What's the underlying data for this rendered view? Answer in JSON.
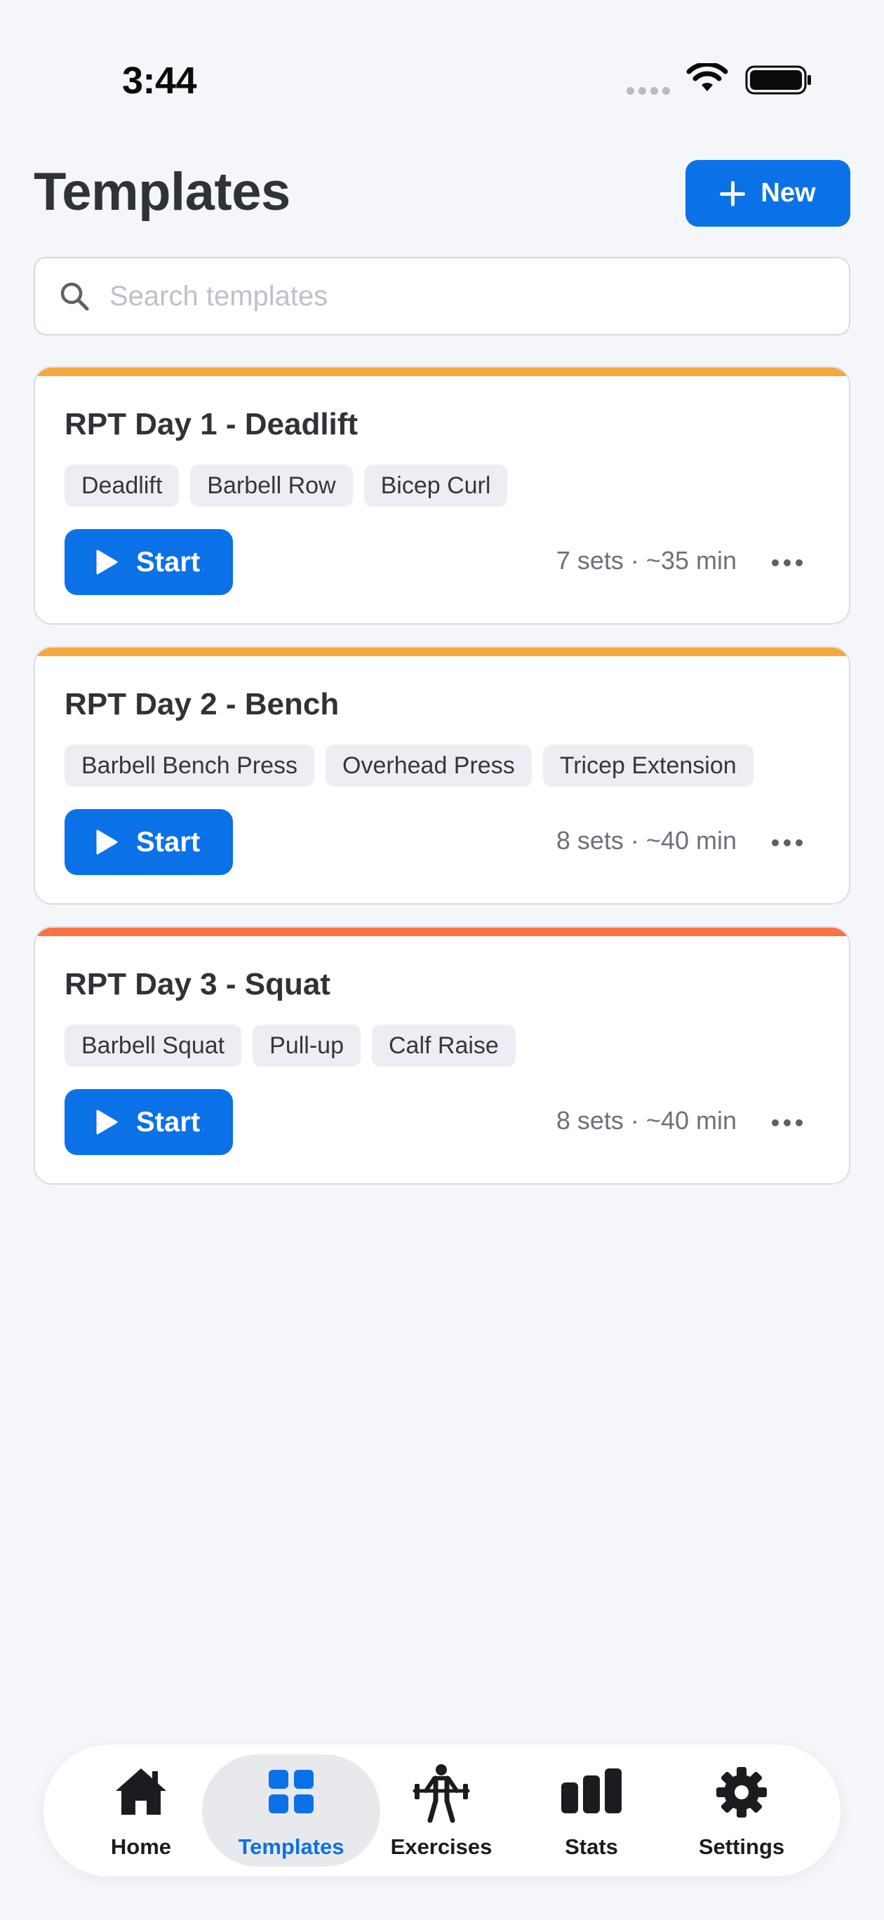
{
  "status_bar": {
    "time": "3:44"
  },
  "header": {
    "title": "Templates",
    "new_button_label": "New"
  },
  "search": {
    "placeholder": "Search templates",
    "value": ""
  },
  "colors": {
    "primary": "#0A72E6",
    "accent_orange": "#F6A83B",
    "accent_red_orange": "#FF7043",
    "background": "#F4F6FA"
  },
  "templates": [
    {
      "title": "RPT Day 1 - Deadlift",
      "accent": "#F6A83B",
      "exercises": [
        "Deadlift",
        "Barbell Row",
        "Bicep Curl"
      ],
      "start_label": "Start",
      "meta": "7 sets · ~35 min"
    },
    {
      "title": "RPT Day 2 - Bench",
      "accent": "#F6A83B",
      "exercises": [
        "Barbell Bench Press",
        "Overhead Press",
        "Tricep Extension"
      ],
      "start_label": "Start",
      "meta": "8 sets · ~40 min"
    },
    {
      "title": "RPT Day 3 - Squat",
      "accent": "#FF7043",
      "exercises": [
        "Barbell Squat",
        "Pull-up",
        "Calf Raise"
      ],
      "start_label": "Start",
      "meta": "8 sets · ~40 min"
    }
  ],
  "tabbar": {
    "active": "templates",
    "tabs": [
      {
        "id": "home",
        "label": "Home",
        "icon": "home-icon"
      },
      {
        "id": "templates",
        "label": "Templates",
        "icon": "grid-icon"
      },
      {
        "id": "exercises",
        "label": "Exercises",
        "icon": "weightlifter-icon"
      },
      {
        "id": "stats",
        "label": "Stats",
        "icon": "bar-chart-icon"
      },
      {
        "id": "settings",
        "label": "Settings",
        "icon": "gear-icon"
      }
    ]
  }
}
